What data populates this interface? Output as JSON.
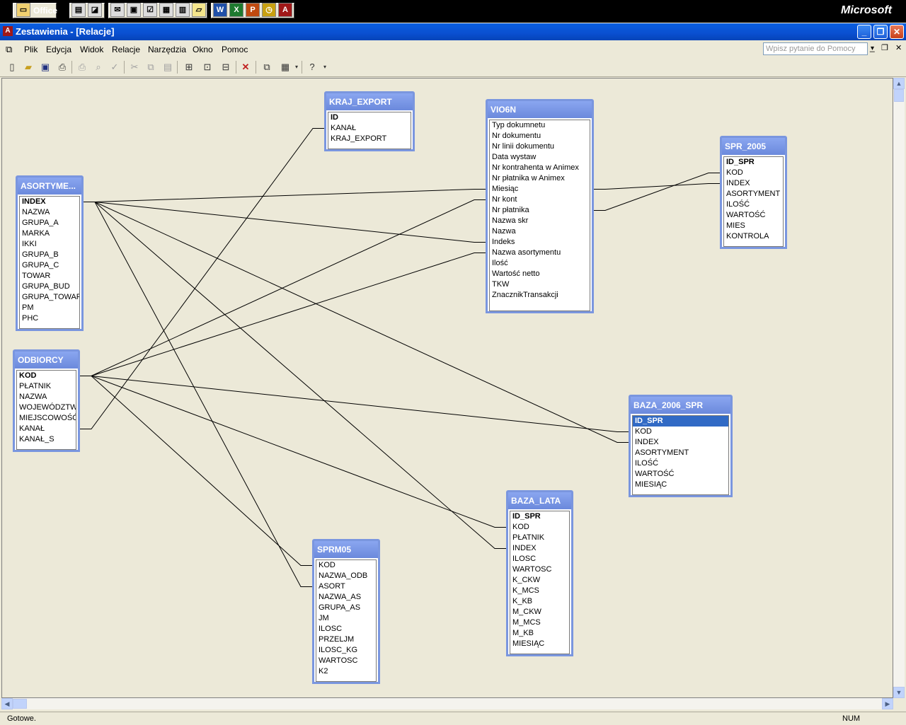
{
  "officebar": {
    "office_label": "Office",
    "brand": "Microsoft",
    "icons": [
      "folder-icon",
      "doc-icon",
      "paint-icon",
      "mail-icon",
      "window-icon",
      "task-icon",
      "note-icon",
      "journal-icon",
      "contacts-icon",
      "word-icon",
      "excel-icon",
      "powerpoint-icon",
      "outlook-icon",
      "access-icon"
    ]
  },
  "window": {
    "title": "Zestawienia - [Relacje]"
  },
  "menu": {
    "items": [
      "Plik",
      "Edycja",
      "Widok",
      "Relacje",
      "Narzędzia",
      "Okno",
      "Pomoc"
    ],
    "help_placeholder": "Wpisz pytanie do Pomocy"
  },
  "tables": [
    {
      "id": "kraj",
      "title": "KRAJ_EXPORT",
      "fields": [
        "ID",
        "KANAŁ",
        "KRAJ_EXPORT"
      ],
      "keys": [
        0
      ]
    },
    {
      "id": "vio",
      "title": "VIO6N",
      "fields": [
        "Typ dokumnetu",
        "Nr dokumentu",
        "Nr linii dokumentu",
        "Data wystaw",
        "Nr kontrahenta w Animex",
        "Nr płatnika w Animex",
        "Miesiąc",
        "Nr kont",
        "Nr płatnika",
        "Nazwa skr",
        "Nazwa",
        "Indeks",
        "Nazwa asortymentu",
        "Ilość",
        "Wartość netto",
        "TKW",
        "ZnacznikTransakcji"
      ],
      "keys": []
    },
    {
      "id": "spr2005",
      "title": "SPR_2005",
      "fields": [
        "ID_SPR",
        "KOD",
        "INDEX",
        "ASORTYMENT",
        "ILOŚĆ",
        "WARTOŚĆ",
        "MIES",
        "KONTROLA"
      ],
      "keys": [
        0
      ]
    },
    {
      "id": "asort",
      "title": "ASORTYME...",
      "fields": [
        "INDEX",
        "NAZWA",
        "GRUPA_A",
        "MARKA",
        "IKKI",
        "GRUPA_B",
        "GRUPA_C",
        "TOWAR",
        "GRUPA_BUD",
        "GRUPA_TOWAR",
        "PM",
        "PHC"
      ],
      "keys": [
        0
      ]
    },
    {
      "id": "odb",
      "title": "ODBIORCY",
      "fields": [
        "KOD",
        "PŁATNIK",
        "NAZWA",
        "WOJEWÓDZTWO",
        "MIEJSCOWOŚĆ",
        "KANAŁ",
        "KANAŁ_S"
      ],
      "keys": [
        0
      ]
    },
    {
      "id": "baza2006",
      "title": "BAZA_2006_SPR",
      "fields": [
        "ID_SPR",
        "KOD",
        "INDEX",
        "ASORTYMENT",
        "ILOŚĆ",
        "WARTOŚĆ",
        "MIESIĄC"
      ],
      "keys": [
        0
      ],
      "selected": 0
    },
    {
      "id": "bazalata",
      "title": "BAZA_LATA",
      "fields": [
        "ID_SPR",
        "KOD",
        "PŁATNIK",
        "INDEX",
        "ILOSC",
        "WARTOSC",
        "K_CKW",
        "K_MCS",
        "K_KB",
        "M_CKW",
        "M_MCS",
        "M_KB",
        "MIESIĄC"
      ],
      "keys": [
        0
      ]
    },
    {
      "id": "sprm05",
      "title": "SPRM05",
      "fields": [
        "KOD",
        "NAZWA_ODB",
        "ASORT",
        "NAZWA_AS",
        "GRUPA_AS",
        "JM",
        "ILOSC",
        "PRZELJM",
        "ILOSC_KG",
        "WARTOSC",
        "K2"
      ],
      "keys": []
    }
  ],
  "relationships": [
    {
      "from": [
        "asort",
        0
      ],
      "to": [
        "vio",
        6
      ]
    },
    {
      "from": [
        "asort",
        0
      ],
      "to": [
        "vio",
        11
      ]
    },
    {
      "from": [
        "asort",
        0
      ],
      "to": [
        "baza2006",
        2
      ]
    },
    {
      "from": [
        "asort",
        0
      ],
      "to": [
        "bazalata",
        3
      ]
    },
    {
      "from": [
        "asort",
        0
      ],
      "to": [
        "sprm05",
        2
      ]
    },
    {
      "from": [
        "odb",
        0
      ],
      "to": [
        "vio",
        7
      ]
    },
    {
      "from": [
        "odb",
        0
      ],
      "to": [
        "vio",
        12
      ]
    },
    {
      "from": [
        "odb",
        0
      ],
      "to": [
        "baza2006",
        1
      ]
    },
    {
      "from": [
        "odb",
        0
      ],
      "to": [
        "bazalata",
        1
      ]
    },
    {
      "from": [
        "odb",
        0
      ],
      "to": [
        "sprm05",
        0
      ]
    },
    {
      "from": [
        "odb",
        5
      ],
      "to": [
        "kraj",
        1
      ]
    },
    {
      "from": [
        "vio",
        6
      ],
      "to": [
        "spr2005",
        2
      ]
    },
    {
      "from": [
        "vio",
        8
      ],
      "to": [
        "spr2005",
        1
      ]
    }
  ],
  "status": {
    "left": "Gotowe.",
    "num": "NUM"
  }
}
